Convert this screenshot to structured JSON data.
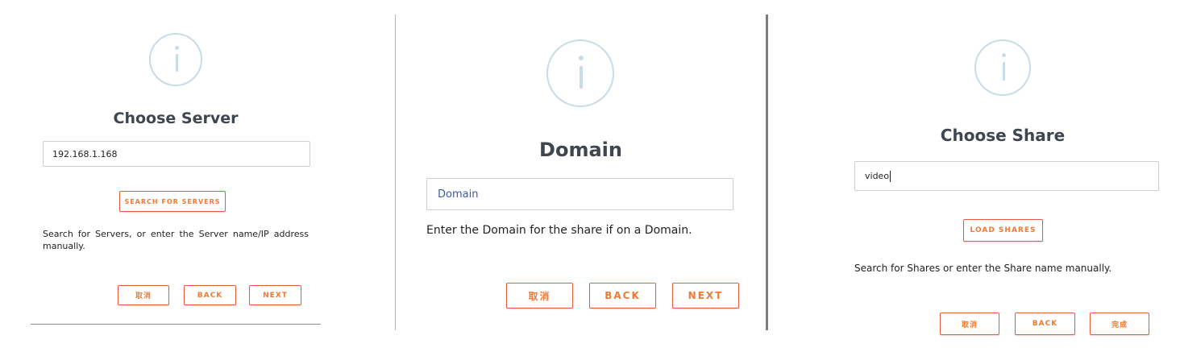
{
  "panels": [
    {
      "title": "Choose Server",
      "input_value": "192.168.1.168",
      "action_button": "SEARCH FOR SERVERS",
      "description": "Search for Servers, or enter the Server name/IP address manually.",
      "buttons": {
        "cancel": "取消",
        "back": "BACK",
        "next": "NEXT"
      }
    },
    {
      "title": "Domain",
      "input_placeholder": "Domain",
      "description": "Enter the Domain for the share if on a Domain.",
      "buttons": {
        "cancel": "取消",
        "back": "BACK",
        "next": "NEXT"
      }
    },
    {
      "title": "Choose Share",
      "input_value": "video",
      "action_button": "LOAD SHARES",
      "description": "Search for Shares or enter the Share name manually.",
      "buttons": {
        "cancel": "取消",
        "back": "BACK",
        "finish": "完成"
      }
    }
  ],
  "icons": {
    "header": "info-icon"
  },
  "colors": {
    "accent": "#ef7a35",
    "border_accent": "#ea5a3c",
    "icon": "#c9dbe5",
    "title": "#3f4650",
    "placeholder": "#3c5aa8"
  }
}
